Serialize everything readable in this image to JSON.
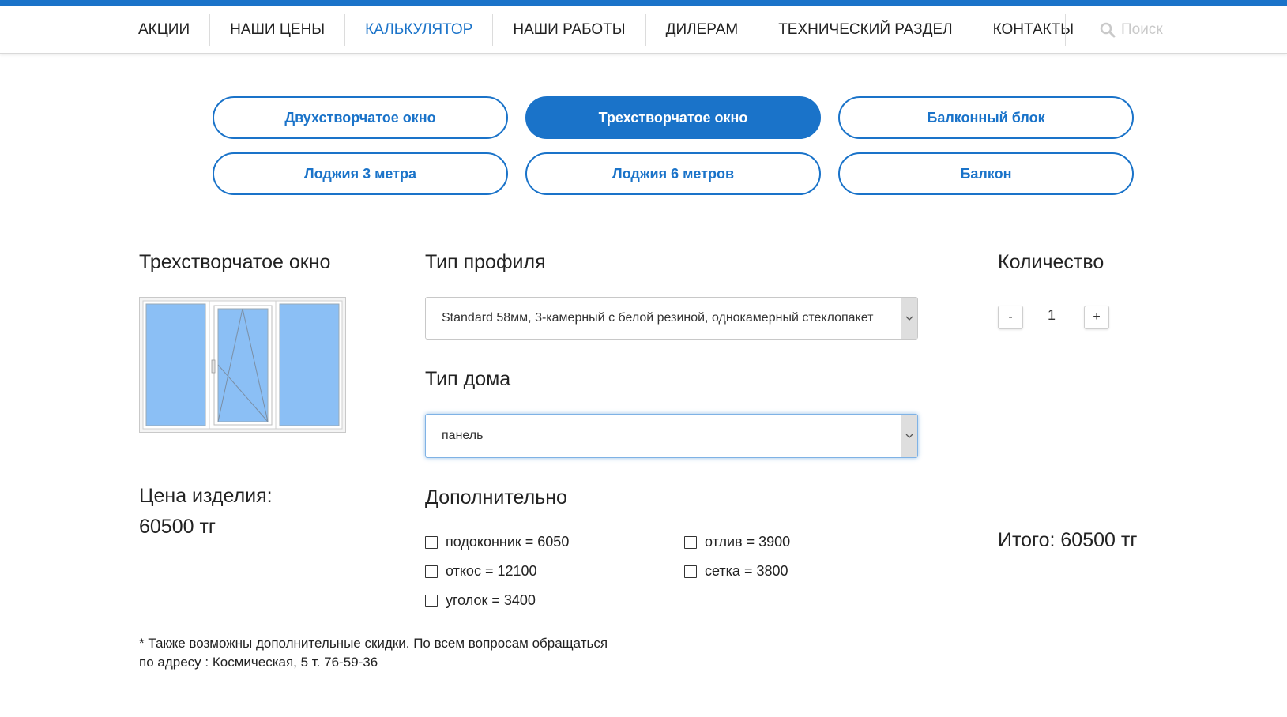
{
  "nav": {
    "items": [
      "АКЦИИ",
      "НАШИ ЦЕНЫ",
      "КАЛЬКУЛЯТОР",
      "НАШИ РАБОТЫ",
      "ДИЛЕРАМ",
      "ТЕХНИЧЕСКИЙ РАЗДЕЛ",
      "КОНТАКТЫ"
    ],
    "active": "КАЛЬКУЛЯТОР",
    "search_placeholder": "Поиск"
  },
  "product_types": {
    "items": [
      "Двухстворчатое окно",
      "Трехстворчатое окно",
      "Балконный блок",
      "Лоджия 3 метра",
      "Лоджия 6 метров",
      "Балкон"
    ],
    "active": "Трехстворчатое окно"
  },
  "product": {
    "title": "Трехстворчатое окно",
    "price_label": "Цена изделия:",
    "price_value": "60500 тг"
  },
  "profile": {
    "title": "Тип профиля",
    "selected": "Standard 58мм, 3-камерный с белой резиной, однокамерный стеклопакет"
  },
  "house": {
    "title": "Тип дома",
    "selected": "панель"
  },
  "quantity": {
    "title": "Количество",
    "minus": "-",
    "value": "1",
    "plus": "+"
  },
  "extras": {
    "title": "Дополнительно",
    "options": [
      {
        "label": "подоконник = 6050",
        "checked": false
      },
      {
        "label": "откос = 12100",
        "checked": false
      },
      {
        "label": "уголок = 3400",
        "checked": false
      },
      {
        "label": "отлив = 3900",
        "checked": false
      },
      {
        "label": "сетка = 3800",
        "checked": false
      }
    ]
  },
  "total": "Итого: 60500 тг",
  "note": {
    "line1": "* Также возможны дополнительные скидки. По всем вопросам обращаться",
    "line2": "по адресу : Космическая, 5 т. 76-59-36"
  },
  "colors": {
    "accent": "#1a73c9",
    "glass": "#8bbff5"
  },
  "icons": {
    "search": "search-icon",
    "select_arrow": "chevron-down-icon"
  }
}
